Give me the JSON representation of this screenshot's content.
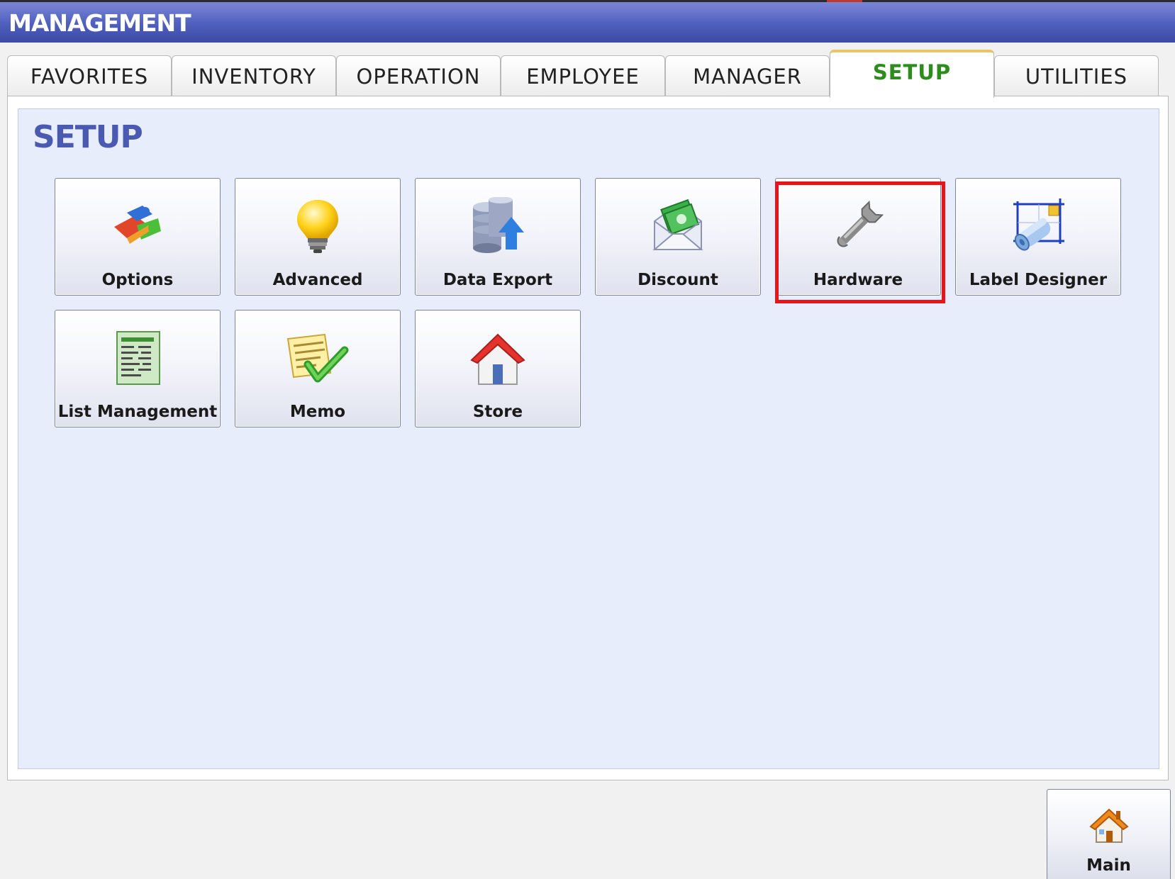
{
  "window": {
    "title": "MANAGEMENT"
  },
  "tabs": [
    {
      "label": "FAVORITES"
    },
    {
      "label": "INVENTORY"
    },
    {
      "label": "OPERATION"
    },
    {
      "label": "EMPLOYEE"
    },
    {
      "label": "MANAGER"
    },
    {
      "label": "SETUP",
      "active": true
    },
    {
      "label": "UTILITIES"
    }
  ],
  "panel": {
    "title": "SETUP"
  },
  "tiles": [
    {
      "label": "Options",
      "icon": "puzzle-icon"
    },
    {
      "label": "Advanced",
      "icon": "lightbulb-icon"
    },
    {
      "label": "Data Export",
      "icon": "database-export-icon"
    },
    {
      "label": "Discount",
      "icon": "money-envelope-icon"
    },
    {
      "label": "Hardware",
      "icon": "wrench-icon",
      "highlighted": true
    },
    {
      "label": "Label Designer",
      "icon": "label-designer-icon"
    },
    {
      "label": "List Management",
      "icon": "list-document-icon"
    },
    {
      "label": "Memo",
      "icon": "memo-check-icon"
    },
    {
      "label": "Store",
      "icon": "store-house-icon"
    }
  ],
  "footer": {
    "main_label": "Main",
    "main_icon": "home-icon"
  },
  "colors": {
    "titlebar": "#4f5fbd",
    "active_tab_text": "#2e8b1e",
    "panel_bg": "#e8edfc",
    "highlight": "#e8141c"
  }
}
